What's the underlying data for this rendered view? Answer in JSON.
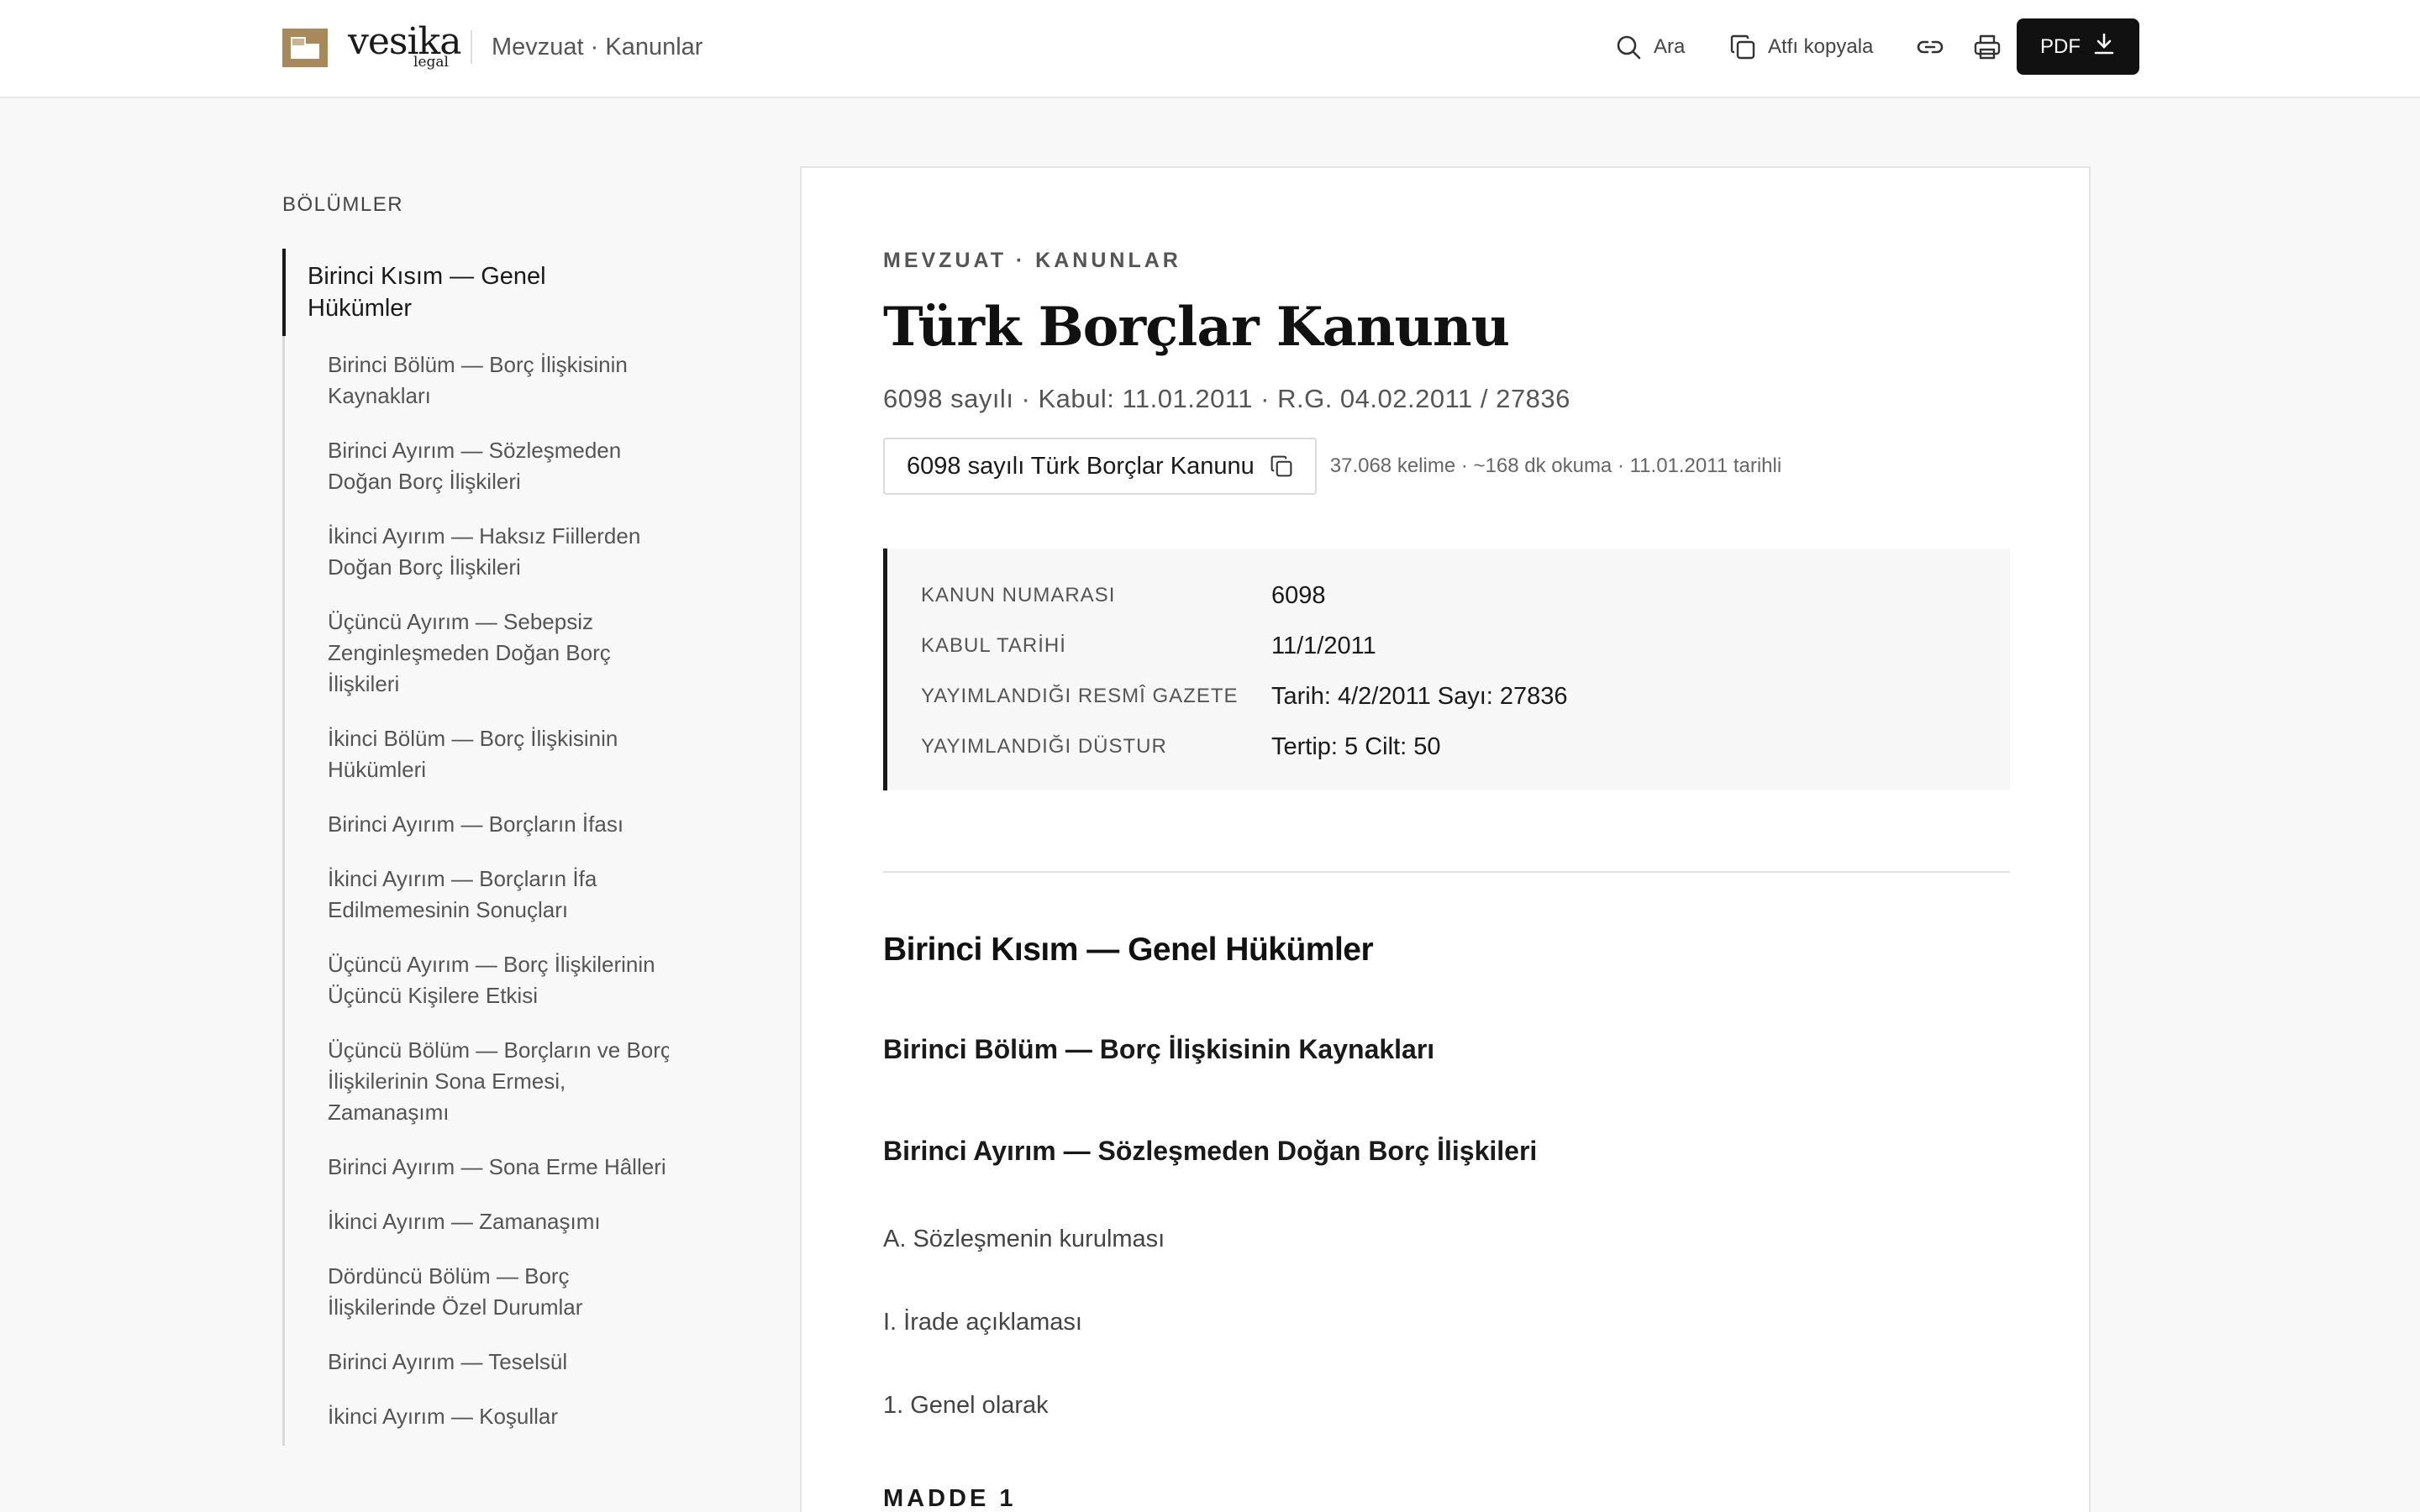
{
  "header": {
    "brand_name": "vesika",
    "brand_sub": "legal",
    "breadcrumb": "Mevzuat · Kanunlar",
    "search_label": "Ara",
    "copy_cite_label": "Atfı kopyala",
    "pdf_label": "PDF",
    "icons": [
      "search-icon",
      "copy-icon",
      "link-icon",
      "print-icon",
      "download-icon"
    ]
  },
  "sidebar": {
    "title": "BÖLÜMLER",
    "active": "Birinci Kısım — Genel Hükümler",
    "items": [
      "Birinci Bölüm — Borç İlişkisinin Kaynakları",
      "Birinci Ayırım — Sözleşmeden Doğan Borç İlişkileri",
      "İkinci Ayırım — Haksız Fiillerden Doğan Borç İlişkileri",
      "Üçüncü Ayırım — Sebepsiz Zenginleşmeden Doğan Borç İlişkileri",
      "İkinci Bölüm — Borç İlişkisinin Hükümleri",
      "Birinci Ayırım — Borçların İfası",
      "İkinci Ayırım — Borçların İfa Edilmemesinin Sonuçları",
      "Üçüncü Ayırım — Borç İlişkilerinin Üçüncü Kişilere Etkisi",
      "Üçüncü Bölüm — Borçların ve Borç İlişkilerinin Sona Ermesi, Zamanaşımı",
      "Birinci Ayırım — Sona Erme Hâlleri",
      "İkinci Ayırım — Zamanaşımı",
      "Dördüncü Bölüm — Borç İlişkilerinde Özel Durumlar",
      "Birinci Ayırım — Teselsül",
      "İkinci Ayırım — Koşullar"
    ]
  },
  "article": {
    "eyebrow": "MEVZUAT · KANUNLAR",
    "title": "Türk Borçlar Kanunu",
    "subline": "6098 sayılı · Kabul: 11.01.2011 · R.G. 04.02.2011 / 27836",
    "citation": "6098 sayılı Türk Borçlar Kanunu",
    "stats": "37.068 kelime · ~168 dk okuma · 11.01.2011 tarihli",
    "meta": [
      {
        "key": "KANUN NUMARASI",
        "value": "6098"
      },
      {
        "key": "KABUL TARİHİ",
        "value": "11/1/2011"
      },
      {
        "key": "YAYIMLANDIĞI RESMÎ GAZETE",
        "value": "Tarih: 4/2/2011 Sayı: 27836"
      },
      {
        "key": "YAYIMLANDIĞI DÜSTUR",
        "value": "Tertip: 5 Cilt: 50"
      }
    ],
    "part_heading": "Birinci Kısım — Genel Hükümler",
    "chapter_heading": "Birinci Bölüm — Borç İlişkisinin Kaynakları",
    "section_heading": "Birinci Ayırım — Sözleşmeden Doğan Borç İlişkileri",
    "line_a": "A. Sözleşmenin kurulması",
    "line_i": "I. İrade açıklaması",
    "line_1": "1. Genel olarak",
    "madde": "MADDE 1"
  },
  "colors": {
    "brand_gold": "#a88a5a",
    "ink": "#111111",
    "page_bg": "#f8f8f8",
    "paper_bg": "#ffffff"
  }
}
